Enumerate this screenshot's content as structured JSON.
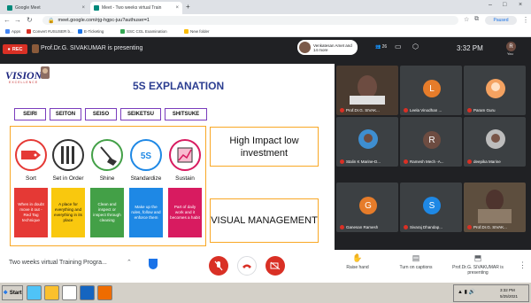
{
  "browser": {
    "tabs": [
      {
        "title": "Google Meet",
        "active": false
      },
      {
        "title": "Meet - Two weeks virtual Train",
        "active": true
      }
    ],
    "new_tab": "+",
    "url": "meet.google.com/rjg-hgpc-juu?authuser=1",
    "paused_label": "Paused",
    "bookmarks": [
      "Apps",
      "Convert #USUSER b...",
      "E-Ticketing",
      "SSC CGL Examination",
      "New folder"
    ]
  },
  "meet": {
    "rec_label": "REC",
    "presenting_banner": "Prof.Dr.G. SIVAKUMAR is presenting",
    "joined_text": "Venkatesan Amet and 14 more",
    "participant_count": "26",
    "time": "3:32 PM",
    "you_initial": "R",
    "you_label": "You",
    "meeting_name": "Two weeks virtual Training Progra...",
    "actions": {
      "raise_hand": "Raise hand",
      "captions": "Turn on captions",
      "presenting": "Prof.Dr.G. SIVAKUMAR is presenting"
    }
  },
  "slide": {
    "logo": "VISION",
    "logo_sub": "EXCELLENCE",
    "title": "5S EXPLANATION",
    "s_words": [
      "SEIRI",
      "SEITON",
      "SEISO",
      "SEIKETSU",
      "SHITSUKE"
    ],
    "columns": [
      {
        "label": "Sort",
        "desc": "When in doubt move it out - Red Tag technique",
        "color": "#e53935"
      },
      {
        "label": "Set in Order",
        "desc": "A place for everything and everything in its place",
        "color": "#f9c80e"
      },
      {
        "label": "Shine",
        "desc": "Clean and inspect or inspect through cleaning",
        "color": "#43a047"
      },
      {
        "label": "Standardize",
        "desc": "Make up the rules, follow and enforce them",
        "color": "#1e88e5"
      },
      {
        "label": "Sustain",
        "desc": "Part of daily work and it becomes a habit",
        "color": "#d81b60"
      }
    ],
    "right_box_1": "High Impact low investment",
    "right_box_2": "VISUAL MANAGEMENT"
  },
  "participants": [
    {
      "name": "Prof.Dr.G. SIVAK...",
      "initial": "",
      "color": "#5d4037",
      "video": true
    },
    {
      "name": "Leela Vinodhan ...",
      "initial": "L",
      "color": "#e67c2a",
      "video": false
    },
    {
      "name": "Param Guru",
      "initial": "",
      "color": "#f4a261",
      "video": false
    },
    {
      "name": "Stalin K Marine-D...",
      "initial": "",
      "color": "#3e8ed0",
      "video": false
    },
    {
      "name": "Ramesh Mech -A...",
      "initial": "R",
      "color": "#6d4c41",
      "video": false
    },
    {
      "name": "deepika Marine",
      "initial": "",
      "color": "#9e9e9e",
      "video": false
    },
    {
      "name": "Ganesan Ramesh",
      "initial": "G",
      "color": "#e67c2a",
      "video": false
    },
    {
      "name": "Sivaraj Dhandap...",
      "initial": "S",
      "color": "#1e88e5",
      "video": false
    },
    {
      "name": "Prof.Dr.G. SIVAK...",
      "initial": "",
      "color": "#6d5a4a",
      "video": true
    }
  ],
  "taskbar": {
    "start_label": "Start",
    "tray_time": "3:32 PM",
    "tray_date": "5/25/2021"
  }
}
